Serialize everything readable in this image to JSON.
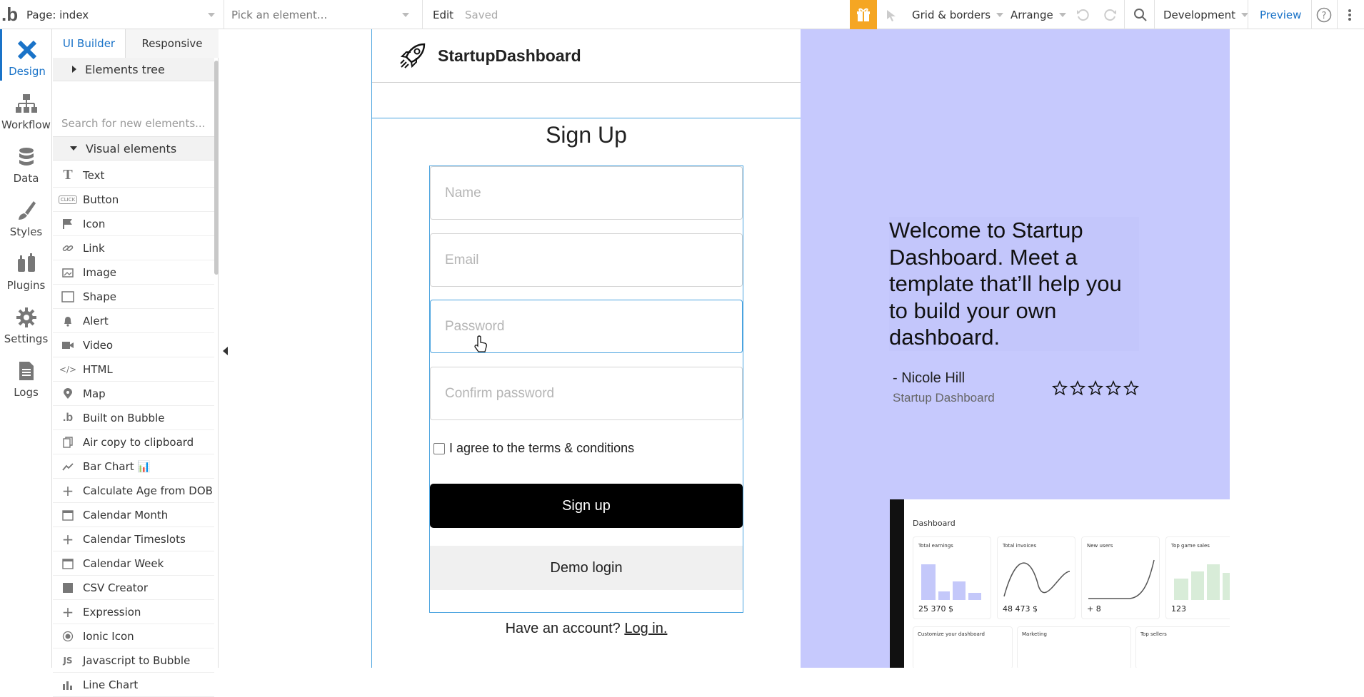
{
  "topbar": {
    "page_label": "Page: index",
    "element_picker": "Pick an element...",
    "edit": "Edit",
    "saved": "Saved",
    "grid_borders": "Grid & borders",
    "arrange": "Arrange",
    "environment": "Development",
    "preview": "Preview",
    "accent_color": "#f5a623"
  },
  "leftnav": {
    "items": [
      {
        "label": "Design",
        "icon": "design-icon"
      },
      {
        "label": "Workflow",
        "icon": "workflow-icon"
      },
      {
        "label": "Data",
        "icon": "database-icon"
      },
      {
        "label": "Styles",
        "icon": "brush-icon"
      },
      {
        "label": "Plugins",
        "icon": "plugin-icon"
      },
      {
        "label": "Settings",
        "icon": "gear-icon"
      },
      {
        "label": "Logs",
        "icon": "document-icon"
      }
    ]
  },
  "panel": {
    "tabs": [
      "UI Builder",
      "Responsive"
    ],
    "elements_tree": "Elements tree",
    "search_placeholder": "Search for new elements...",
    "visual_elements": "Visual elements",
    "elements": [
      {
        "label": "Text",
        "icon": "T"
      },
      {
        "label": "Button",
        "icon": "CLICK"
      },
      {
        "label": "Icon",
        "icon": "flag"
      },
      {
        "label": "Link",
        "icon": "link"
      },
      {
        "label": "Image",
        "icon": "image"
      },
      {
        "label": "Shape",
        "icon": "square"
      },
      {
        "label": "Alert",
        "icon": "bell"
      },
      {
        "label": "Video",
        "icon": "video"
      },
      {
        "label": "HTML",
        "icon": "</>"
      },
      {
        "label": "Map",
        "icon": "pin"
      },
      {
        "label": "Built on Bubble",
        "icon": "b"
      },
      {
        "label": "Air copy to clipboard",
        "icon": "copy"
      },
      {
        "label": "Bar Chart 📊",
        "icon": "trend"
      },
      {
        "label": "Calculate Age from DOB",
        "icon": "+"
      },
      {
        "label": "Calendar Month",
        "icon": "cal"
      },
      {
        "label": "Calendar Timeslots",
        "icon": "+"
      },
      {
        "label": "Calendar Week",
        "icon": "cal"
      },
      {
        "label": "CSV Creator",
        "icon": "square-fill"
      },
      {
        "label": "Expression",
        "icon": "+"
      },
      {
        "label": "Ionic Icon",
        "icon": "circle"
      },
      {
        "label": "Javascript to Bubble",
        "icon": "JS"
      },
      {
        "label": "Line Chart",
        "icon": "bars"
      }
    ]
  },
  "app": {
    "brand": "StartupDashboard",
    "title": "Sign Up",
    "fields": [
      {
        "placeholder": "Name"
      },
      {
        "placeholder": "Email"
      },
      {
        "placeholder": "Password"
      },
      {
        "placeholder": "Confirm password"
      }
    ],
    "terms": "I agree to the terms & conditions",
    "signup_button": "Sign up",
    "demo_button": "Demo login",
    "have_account": "Have an account? ",
    "login_link": "Log in.",
    "quote": "Welcome to Startup Dashboard. Meet a template that’ll help you to build your own dashboard.",
    "author": "- Nicole Hill",
    "company": "Startup Dashboard",
    "rating": "0 of 5 stars",
    "accent_bg": "#c6c9fd"
  },
  "dashboard_preview": {
    "title": "Dashboard",
    "cards": [
      {
        "title": "Total earnings",
        "value": "25 370 $"
      },
      {
        "title": "Total invoices",
        "value": "48 473 $"
      },
      {
        "title": "New users",
        "value": "+ 8"
      },
      {
        "title": "Top game sales",
        "value": "123"
      }
    ],
    "customize": "Customize your dashboard",
    "marketing": "Marketing",
    "top_sellers": "Top sellers"
  }
}
